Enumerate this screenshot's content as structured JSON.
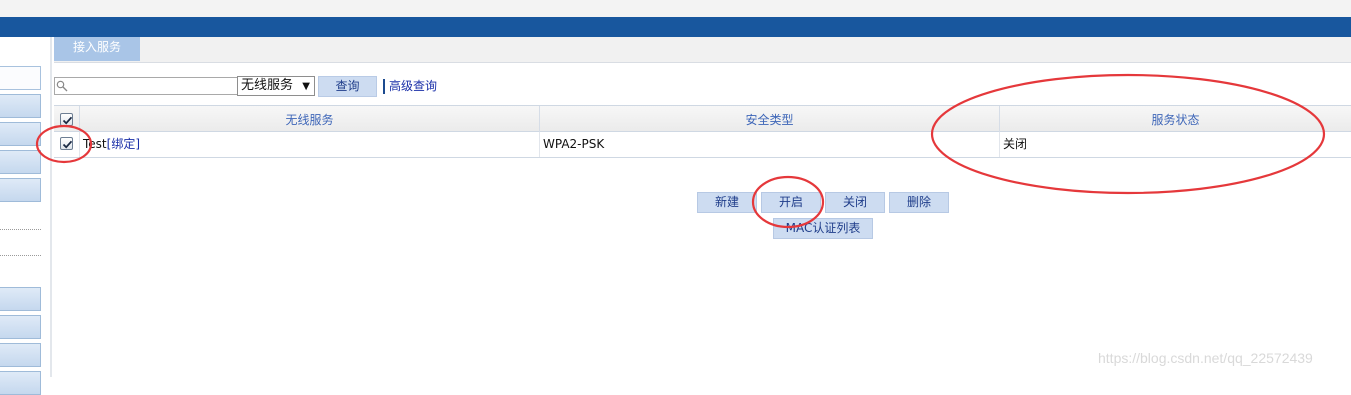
{
  "tabs": [
    {
      "label": "接入服务",
      "active": true
    }
  ],
  "search": {
    "placeholder": "",
    "value": ""
  },
  "filter_select": {
    "selected": "无线服务"
  },
  "buttons": {
    "query": "查询",
    "advanced_query": "高级查询"
  },
  "table": {
    "columns": [
      "无线服务",
      "安全类型",
      "服务状态"
    ],
    "header_checked": true,
    "rows": [
      {
        "checked": true,
        "name": "Test",
        "bind_label": "[绑定]",
        "security": "WPA2-PSK",
        "status": "关闭"
      }
    ]
  },
  "actions": {
    "new": "新建",
    "open": "开启",
    "close": "关闭",
    "delete": "删除",
    "mac_list": "MAC认证列表"
  },
  "watermark": "https://blog.csdn.net/qq_22572439",
  "colors": {
    "header_blue": "#18579e",
    "tab_blue": "#a9c5e7",
    "button_blue": "#cddcf1",
    "annotation_red": "#e5383b"
  }
}
